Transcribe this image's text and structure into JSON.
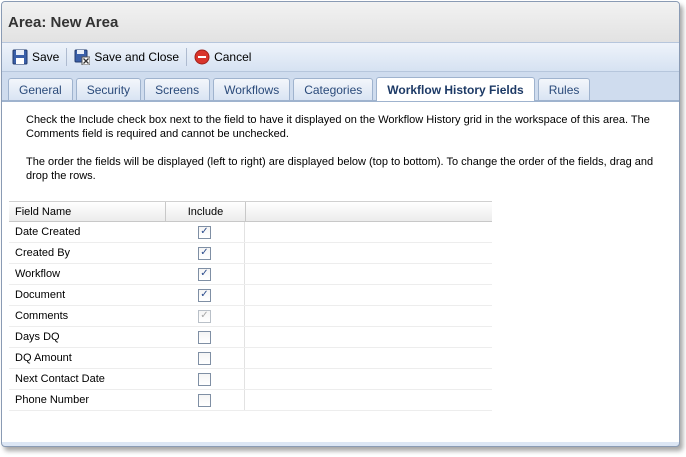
{
  "window": {
    "title": "Area: New Area"
  },
  "toolbar": {
    "save_label": "Save",
    "save_close_label": "Save and Close",
    "cancel_label": "Cancel",
    "icons": {
      "save": "floppy-disk-icon",
      "save_close": "floppy-close-icon",
      "cancel": "cancel-icon"
    }
  },
  "tabs": [
    {
      "label": "General",
      "active": false
    },
    {
      "label": "Security",
      "active": false
    },
    {
      "label": "Screens",
      "active": false
    },
    {
      "label": "Workflows",
      "active": false
    },
    {
      "label": "Categories",
      "active": false
    },
    {
      "label": "Workflow History Fields",
      "active": true
    },
    {
      "label": "Rules",
      "active": false
    }
  ],
  "instructions": {
    "line1": "Check the Include check box next to the field to have it displayed on the Workflow History grid in the workspace of this area. The Comments field is required and cannot be unchecked.",
    "line2": "The order the fields will be displayed (left to right) are displayed below (top to bottom). To change the order of the fields, drag and drop the rows."
  },
  "grid": {
    "headers": {
      "field_name": "Field Name",
      "include": "Include"
    },
    "rows": [
      {
        "name": "Date Created",
        "include": true,
        "disabled": false
      },
      {
        "name": "Created By",
        "include": true,
        "disabled": false
      },
      {
        "name": "Workflow",
        "include": true,
        "disabled": false
      },
      {
        "name": "Document",
        "include": true,
        "disabled": false
      },
      {
        "name": "Comments",
        "include": true,
        "disabled": true
      },
      {
        "name": "Days DQ",
        "include": false,
        "disabled": false
      },
      {
        "name": "DQ Amount",
        "include": false,
        "disabled": false
      },
      {
        "name": "Next Contact Date",
        "include": false,
        "disabled": false
      },
      {
        "name": "Phone Number",
        "include": false,
        "disabled": false
      }
    ]
  },
  "colors": {
    "accent": "#2a4a7a",
    "toolbar_bg": "#dce6f4",
    "cancel_red": "#d9342b"
  }
}
